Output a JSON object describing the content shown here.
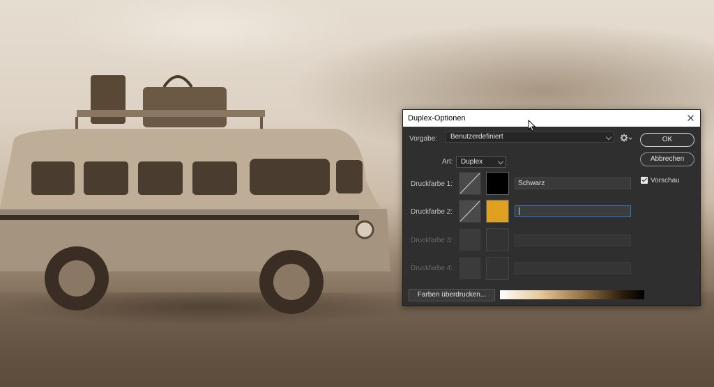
{
  "dialog": {
    "title": "Duplex-Optionen",
    "preset_label": "Vorgabe:",
    "preset_value": "Benutzerdefiniert",
    "type_label": "Art:",
    "type_value": "Duplex",
    "inks": [
      {
        "label": "Druckfarbe 1:",
        "name": "Schwarz",
        "color": "#000000",
        "enabled": true
      },
      {
        "label": "Druckfarbe 2:",
        "name": "",
        "color": "#e0a020",
        "enabled": true,
        "editing": true
      },
      {
        "label": "Druckfarbe 3:",
        "name": "",
        "color": "#3b3b3b",
        "enabled": false
      },
      {
        "label": "Druckfarbe 4:",
        "name": "",
        "color": "#3b3b3b",
        "enabled": false
      }
    ],
    "ok_label": "OK",
    "cancel_label": "Abbrechen",
    "preview_label": "Vorschau",
    "preview_checked": true,
    "overprint_label": "Farben überdrucken..."
  },
  "icons": {
    "close": "close-icon",
    "gear": "gear-icon",
    "chevron": "chevron-down-icon"
  },
  "colors": {
    "dialog_bg": "#2f2f2f",
    "accent_focus": "#2f73c9",
    "ink2": "#e0a020"
  }
}
